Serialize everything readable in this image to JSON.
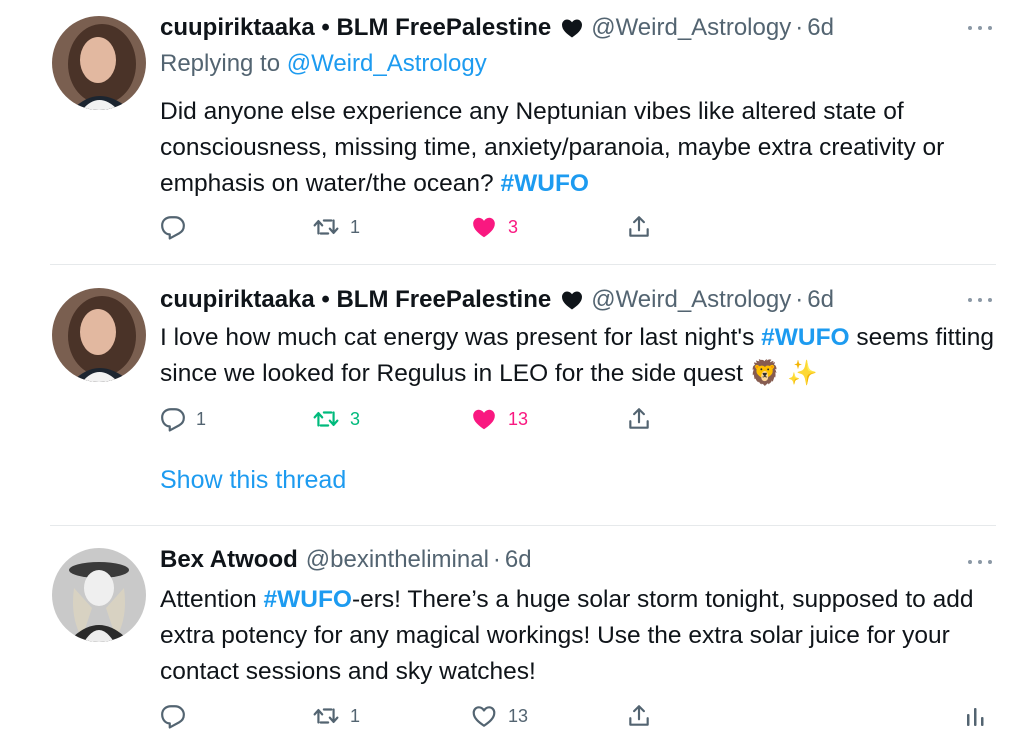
{
  "tweets": [
    {
      "name": "cuupiriktaaka • BLM FreePalestine",
      "name_emoji": "black-heart",
      "handle": "@Weird_Astrology",
      "separator": "·",
      "time": "6d",
      "replying_label": "Replying to",
      "replying_handle": "@Weird_Astrology",
      "text_before": "Did anyone else experience any Neptunian vibes like altered state of consciousness, missing time, anxiety/paranoia, maybe extra creativity or emphasis on water/the ocean? ",
      "hashtag": "#WUFO",
      "text_after": "",
      "reply_count": "",
      "retweet_count": "1",
      "like_count": "3",
      "liked": true,
      "retweeted": false
    },
    {
      "name": "cuupiriktaaka • BLM FreePalestine",
      "name_emoji": "black-heart",
      "handle": "@Weird_Astrology",
      "separator": "·",
      "time": "6d",
      "text_before": "I love how much cat energy was present for last night's ",
      "hashtag": "#WUFO",
      "text_after": " seems fitting since we looked for Regulus in LEO for the side quest",
      "text_emojis": "🦁 ✨",
      "reply_count": "1",
      "retweet_count": "3",
      "like_count": "13",
      "liked": true,
      "retweeted": true,
      "show_thread": "Show this thread"
    },
    {
      "name": "Bex Atwood",
      "handle": "@bexintheliminal",
      "separator": "·",
      "time": "6d",
      "text_before": "Attention ",
      "hashtag": "#WUFO",
      "text_after": "-ers! There’s a huge solar storm tonight, supposed to add extra potency for any magical workings! Use the extra solar juice for your contact sessions and sky watches!",
      "reply_count": "",
      "retweet_count": "1",
      "like_count": "13",
      "liked": false,
      "retweeted": false
    }
  ],
  "colors": {
    "accent": "#1d9bf0",
    "like": "#f91880",
    "retweet": "#00ba7c",
    "muted": "#536471"
  },
  "icons": [
    "reply-icon",
    "retweet-icon",
    "like-icon",
    "share-icon",
    "more-icon",
    "analytics-icon"
  ]
}
